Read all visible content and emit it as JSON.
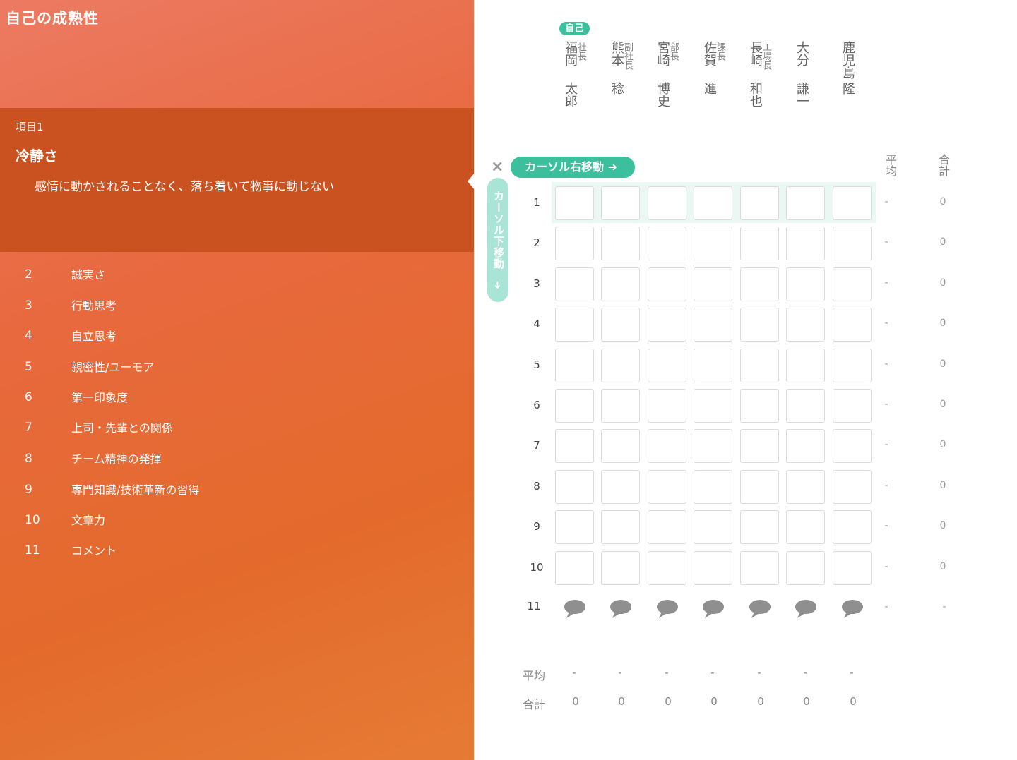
{
  "app_title": "自己の成熟性",
  "active_item": {
    "number_label": "項目1",
    "name": "冷静さ",
    "description": "感情に動かされることなく、落ち着いて物事に動じない"
  },
  "nav_items": [
    {
      "num": "2",
      "label": "誠実さ"
    },
    {
      "num": "3",
      "label": "行動思考"
    },
    {
      "num": "4",
      "label": "自立思考"
    },
    {
      "num": "5",
      "label": "親密性/ユーモア"
    },
    {
      "num": "6",
      "label": "第一印象度"
    },
    {
      "num": "7",
      "label": "上司・先輩との関係"
    },
    {
      "num": "8",
      "label": "チーム精神の発揮"
    },
    {
      "num": "9",
      "label": "専門知識/技術革新の習得"
    },
    {
      "num": "10",
      "label": "文章力"
    },
    {
      "num": "11",
      "label": "コメント"
    }
  ],
  "self_badge": "自己",
  "people": [
    {
      "surname": "福岡",
      "given": "太郎",
      "title": "社長"
    },
    {
      "surname": "熊本",
      "given": "稔",
      "title": "副社長"
    },
    {
      "surname": "宮崎",
      "given": "博史",
      "title": "部長"
    },
    {
      "surname": "佐賀",
      "given": "進",
      "title": "課長"
    },
    {
      "surname": "長崎",
      "given": "和也",
      "title": "工場長"
    },
    {
      "surname": "大分",
      "given": "謙一",
      "title": ""
    },
    {
      "surname": "鹿児島",
      "given": "隆",
      "title": ""
    }
  ],
  "controls": {
    "close_icon": "×",
    "cursor_right_label": "カーソル右移動 ➜",
    "cursor_down_label": "カーソル下移動",
    "cursor_down_arrow": "➜"
  },
  "column_headers": {
    "avg": "平均",
    "sum": "合計"
  },
  "rows": [
    {
      "num": "1",
      "avg": "-",
      "sum": "0"
    },
    {
      "num": "2",
      "avg": "-",
      "sum": "0"
    },
    {
      "num": "3",
      "avg": "-",
      "sum": "0"
    },
    {
      "num": "4",
      "avg": "-",
      "sum": "0"
    },
    {
      "num": "5",
      "avg": "-",
      "sum": "0"
    },
    {
      "num": "6",
      "avg": "-",
      "sum": "0"
    },
    {
      "num": "7",
      "avg": "-",
      "sum": "0"
    },
    {
      "num": "8",
      "avg": "-",
      "sum": "0"
    },
    {
      "num": "9",
      "avg": "-",
      "sum": "0"
    },
    {
      "num": "10",
      "avg": "-",
      "sum": "0"
    }
  ],
  "comment_row": {
    "num": "11",
    "avg": "-",
    "sum": "-"
  },
  "footer": {
    "avg_label": "平均",
    "sum_label": "合計",
    "avg_values": [
      "-",
      "-",
      "-",
      "-",
      "-",
      "-",
      "-"
    ],
    "sum_values": [
      "0",
      "0",
      "0",
      "0",
      "0",
      "0",
      "0"
    ]
  },
  "colors": {
    "accent": "#3cbf9d",
    "panel": "#e36a2c",
    "active": "#c95220"
  }
}
